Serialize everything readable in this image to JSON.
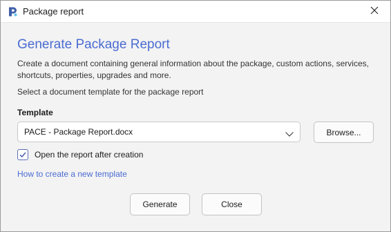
{
  "window": {
    "title": "Package report",
    "app_icon": "pace-logo-icon",
    "close_icon": "close-icon"
  },
  "main": {
    "heading": "Generate Package Report",
    "description": "Create a document containing general information about the package, custom actions, services, shortcuts, properties, upgrades and more.",
    "instruction": "Select a document template for the package report"
  },
  "template": {
    "label": "Template",
    "selected": "PACE - Package Report.docx",
    "dropdown_icon": "chevron-down-icon",
    "browse_label": "Browse..."
  },
  "options": {
    "open_after_creation_label": "Open the report after creation",
    "open_after_creation_checked": true
  },
  "help_link": "How to create a new template",
  "actions": {
    "generate_label": "Generate",
    "close_label": "Close"
  },
  "colors": {
    "accent": "#4a6bd2",
    "window_bg": "#f3f3f3",
    "titlebar_bg": "#ffffff",
    "checkbox_fill": "#4a5fb0"
  }
}
